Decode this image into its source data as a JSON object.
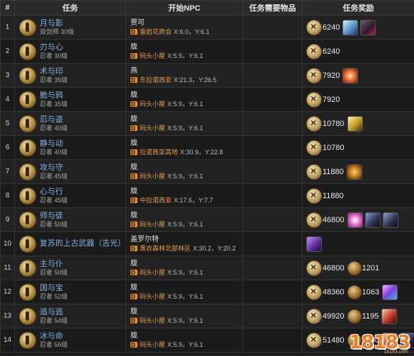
{
  "headers": {
    "num": "#",
    "quest": "任务",
    "npc": "开始NPC",
    "items": "任务需要物品",
    "reward": "任务奖励"
  },
  "rows": [
    {
      "num": "1",
      "name": "月与影",
      "sub": "双剑师 30级",
      "npc": "贾可",
      "place": "雷岩花商会",
      "coord": "X:6.0，Y:6.1",
      "gil": "6240",
      "medals": [],
      "items": [
        "it-blue",
        "it-dark"
      ]
    },
    {
      "num": "2",
      "name": "刃与心",
      "sub": "忍者 30级",
      "npc": "胧",
      "place": "码头小屋",
      "coord": "X:5.9，Y:6.1",
      "gil": "6240",
      "medals": [],
      "items": []
    },
    {
      "num": "3",
      "name": "术与印",
      "sub": "忍者 35级",
      "npc": "燕",
      "place": "东拉诺西亚",
      "coord": "X:21.3，Y:26.5",
      "gil": "7920",
      "medals": [],
      "items": [
        "it-fire"
      ]
    },
    {
      "num": "4",
      "name": "脆与鸦",
      "sub": "忍者 35级",
      "npc": "胧",
      "place": "码头小屋",
      "coord": "X:5.9，Y:6.1",
      "gil": "7920",
      "medals": [],
      "items": []
    },
    {
      "num": "5",
      "name": "忍与盗",
      "sub": "忍者 40级",
      "npc": "胧",
      "place": "码头小屋",
      "coord": "X:5.9，Y:6.1",
      "gil": "10780",
      "medals": [],
      "items": [
        "it-gold"
      ]
    },
    {
      "num": "6",
      "name": "静与动",
      "sub": "忍者 40级",
      "npc": "胧",
      "place": "拉诺西亚高地",
      "coord": "X:30.9，Y:22.8",
      "gil": "10780",
      "medals": [],
      "items": []
    },
    {
      "num": "7",
      "name": "攻与守",
      "sub": "忍者 45级",
      "npc": "胧",
      "place": "码头小屋",
      "coord": "X:5.9，Y:6.1",
      "gil": "11880",
      "medals": [],
      "items": [
        "it-swirl"
      ]
    },
    {
      "num": "8",
      "name": "心与行",
      "sub": "忍者 45级",
      "npc": "胧",
      "place": "中拉诺西亚",
      "coord": "X:17.6，Y:7.7",
      "gil": "11880",
      "medals": [],
      "items": []
    },
    {
      "num": "9",
      "name": "师与徒",
      "sub": "忍者 50级",
      "npc": "胧",
      "place": "码头小屋",
      "coord": "X:5.9，Y:6.1",
      "gil": "46800",
      "medals": [],
      "items": [
        "it-pink",
        "it-night",
        "it-night"
      ]
    },
    {
      "num": "10",
      "name": "复苏的上古武器（吉光）",
      "sub": "",
      "npc": "盖罗尔特",
      "place": "黑衣森林北部林区",
      "coord": "X:30.2，Y:20.2",
      "gil": "",
      "medals": [],
      "items": [
        "it-purple"
      ]
    },
    {
      "num": "11",
      "name": "主与仆",
      "sub": "忍者 50级",
      "npc": "胧",
      "place": "码头小屋",
      "coord": "X:5.9，Y:6.1",
      "gil": "46800",
      "medals": [
        "1201"
      ],
      "items": []
    },
    {
      "num": "12",
      "name": "国与宝",
      "sub": "忍者 52级",
      "npc": "胧",
      "place": "码头小屋",
      "coord": "X:5.9，Y:6.1",
      "gil": "48360",
      "medals": [
        "1063"
      ],
      "items": [
        "it-rainbow"
      ]
    },
    {
      "num": "13",
      "name": "追与逃",
      "sub": "忍者 54级",
      "npc": "胧",
      "place": "码头小屋",
      "coord": "X:5.9，Y:6.1",
      "gil": "49920",
      "medals": [
        "1195"
      ],
      "items": [
        "it-red"
      ]
    },
    {
      "num": "14",
      "name": "冰与命",
      "sub": "忍者 56级",
      "npc": "胧",
      "place": "码头小屋",
      "coord": "X:5.9，Y:6.1",
      "gil": "51480",
      "medals": [
        "1330"
      ],
      "items": [
        "it-red",
        "it-night"
      ]
    }
  ],
  "watermark": {
    "text": "18183",
    "sub": "18183.com"
  }
}
